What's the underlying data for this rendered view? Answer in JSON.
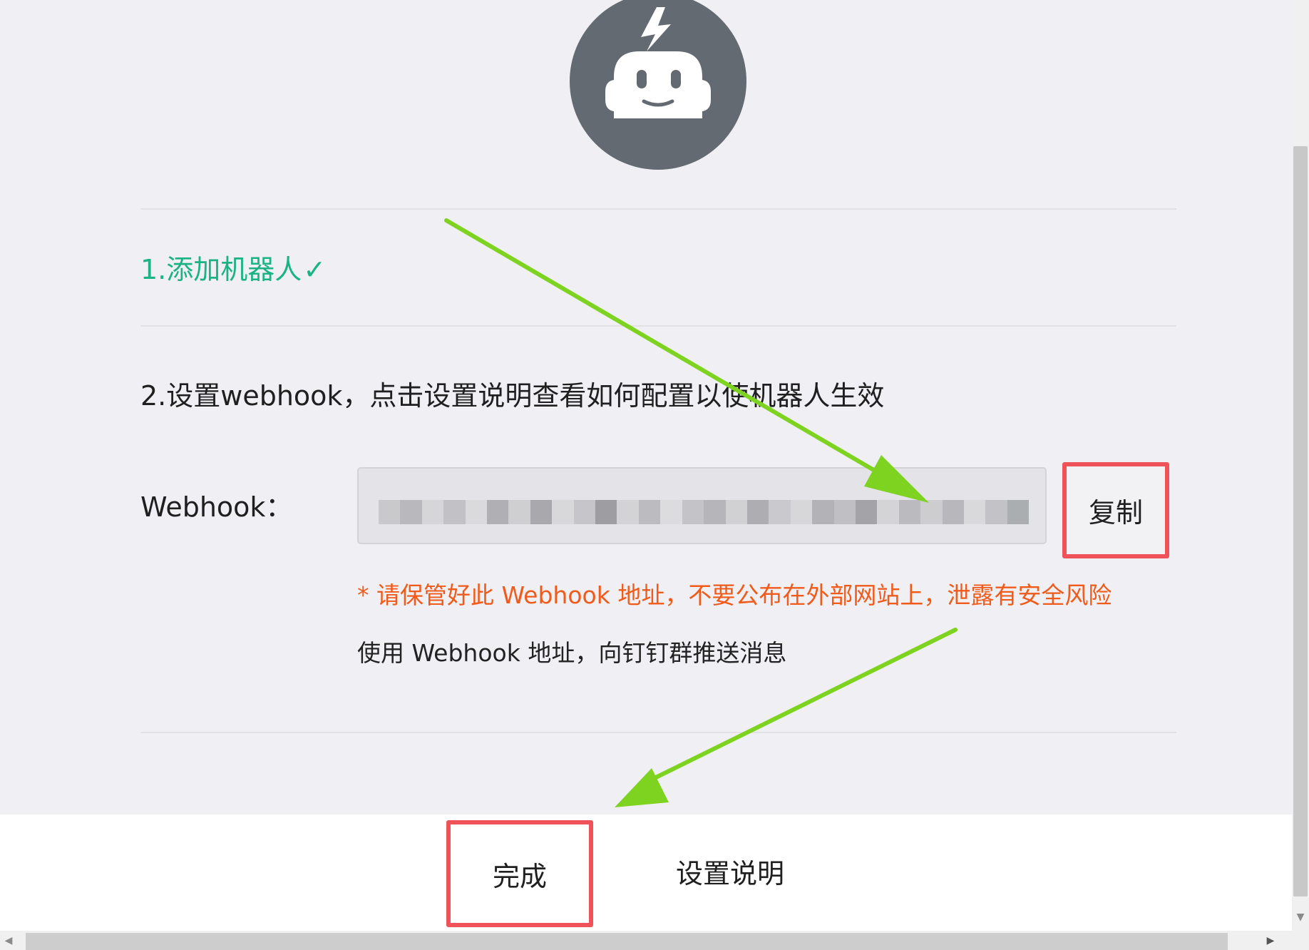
{
  "step1": {
    "label": "1.添加机器人",
    "check": "✓"
  },
  "step2": {
    "label": "2.设置webhook，点击设置说明查看如何配置以使机器人生效"
  },
  "webhook": {
    "label": "Webhook：",
    "value_obscured": true,
    "copy_label": "复制",
    "warning": "* 请保管好此 Webhook 地址，不要公布在外部网站上，泄露有安全风险",
    "usage": "使用 Webhook 地址，向钉钉群推送消息"
  },
  "footer": {
    "done_label": "完成",
    "guide_label": "设置说明"
  },
  "icons": {
    "avatar": "robot-icon",
    "check": "check-icon"
  },
  "colors": {
    "success_green": "#1bb383",
    "warning_orange": "#f05a1a",
    "highlight_red": "#f0525a",
    "arrow_green": "#7ed321",
    "avatar_gray": "#646a71"
  }
}
